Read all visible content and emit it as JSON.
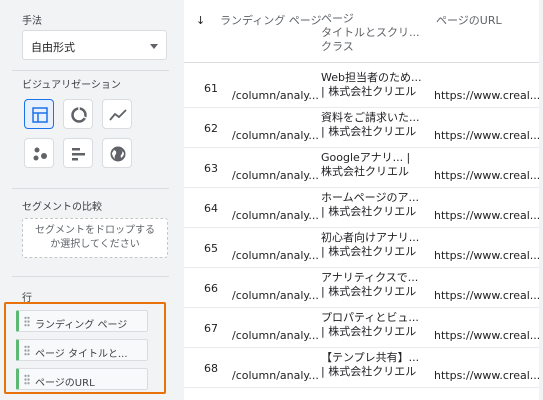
{
  "left_panel": {
    "technique_label": "手法",
    "technique_value": "自由形式",
    "visualization_label": "ビジュアリゼーション",
    "segment_compare_label": "セグメントの比較",
    "segment_drop_text_1": "セグメントをドロップする",
    "segment_drop_text_2": "か選択してください",
    "rows_label": "行",
    "row_chips": [
      "ランディング ページ",
      "ページ タイトルと...",
      "ページのURL"
    ]
  },
  "table": {
    "sort_icon": "↓",
    "headers": {
      "landing": "ランディング ページ",
      "title_1": "ページ",
      "title_2": "タイトルとスクリ...",
      "title_3": "クラス",
      "url": "ページのURL"
    },
    "rows": [
      {
        "num": "61",
        "landing": "/column/analy...",
        "t1": "Web担当者のため...",
        "t2": "| 株式会社クリエル",
        "url": "https://www.creal..."
      },
      {
        "num": "62",
        "landing": "/column/analy...",
        "t1": "資料をご請求いた...",
        "t2": "| 株式会社クリエル",
        "url": "https://www.creal..."
      },
      {
        "num": "63",
        "landing": "/column/analy...",
        "t1": "Googleアナリ... |",
        "t2": "株式会社クリエル",
        "url": "https://www.creal..."
      },
      {
        "num": "64",
        "landing": "/column/analy...",
        "t1": "ホームページのア...",
        "t2": "| 株式会社クリエル",
        "url": "https://www.creal..."
      },
      {
        "num": "65",
        "landing": "/column/analy...",
        "t1": "初心者向けアナリ...",
        "t2": "| 株式会社クリエル",
        "url": "https://www.creal..."
      },
      {
        "num": "66",
        "landing": "/column/analy...",
        "t1": "アナリティクスで...",
        "t2": "| 株式会社クリエル",
        "url": "https://www.creal..."
      },
      {
        "num": "67",
        "landing": "/column/analy...",
        "t1": "プロパティとビュ...",
        "t2": "| 株式会社クリエル",
        "url": "https://www.creal..."
      },
      {
        "num": "68",
        "landing": "/column/analy...",
        "t1": "【テンプレ共有】...",
        "t2": "| 株式会社クリエル",
        "url": "https://www.creal..."
      }
    ]
  },
  "colors": {
    "accent": "#1a73e8",
    "highlight_border": "#e8710a",
    "chip_accent": "#5bb974"
  },
  "icons": [
    "table-icon",
    "donut-chart-icon",
    "line-chart-icon",
    "scatter-icon",
    "bar-chart-icon",
    "globe-icon",
    "chevron-down-icon",
    "sort-down-icon",
    "drag-handle-icon"
  ]
}
